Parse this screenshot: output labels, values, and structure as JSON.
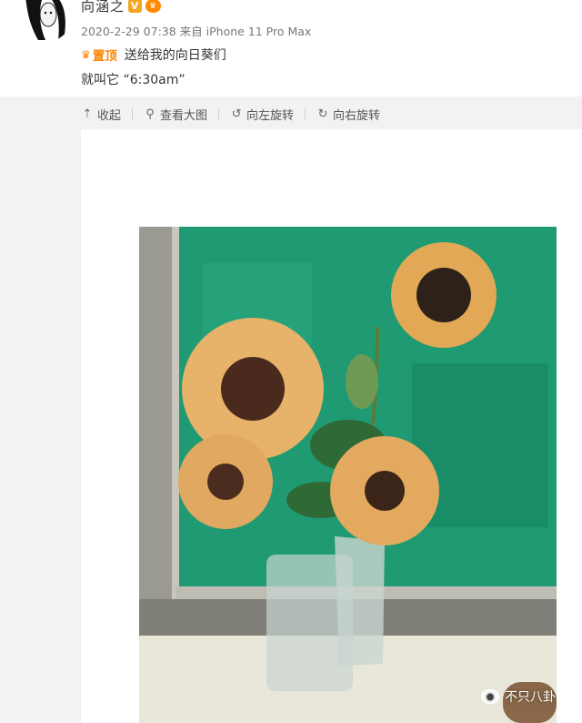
{
  "post": {
    "username": "向涵之",
    "verified_badge": "V",
    "meta": "2020-2-29 07:38 来自 iPhone 11 Pro Max",
    "pin_label": "置顶",
    "text_line1": "送给我的向日葵们",
    "text_line2": "就叫它 “6:30am”"
  },
  "toolbar": {
    "collapse": "收起",
    "view_large": "查看大图",
    "rotate_left": "向左旋转",
    "rotate_right": "向右旋转"
  },
  "watermark": {
    "text": "不只八卦"
  },
  "colors": {
    "pin_accent": "#ff8200",
    "badge": "#f5a623",
    "page_bg": "#f2f2f5"
  },
  "icons": [
    "avatar",
    "verified-badge-icon",
    "crown-icon",
    "collapse-icon",
    "zoom-icon",
    "rotate-left-icon",
    "rotate-right-icon",
    "wechat-icon"
  ]
}
